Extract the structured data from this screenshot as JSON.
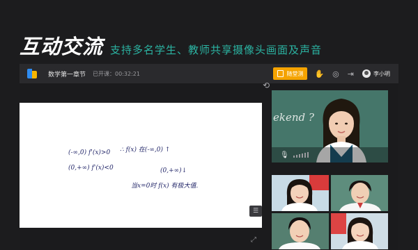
{
  "hero": {
    "title": "互动交流",
    "subtitle": "支持多名学生、教师共享摄像头画面及声音"
  },
  "topbar": {
    "course_title": "数学第一章节",
    "timer_label": "已开课：",
    "timer_value": "00:32:21",
    "quiz_button": "随堂测",
    "user_name": "李小明"
  },
  "board": {
    "lines": [
      "(-∞,0) f'(x)>0",
      "∴ f(x) 在(-∞,0) ↑",
      "(0,+∞) f'(x)<0",
      "(0,+∞)↓",
      "当x=0时 f(x) 有极大值."
    ]
  },
  "teacher_cam": {
    "chalk_text": "ekend ?"
  },
  "colors": {
    "accent": "#2bb3a2",
    "quiz_button": "#f5a300",
    "topbar": "#2a2a2d",
    "background": "#1c1c1e"
  }
}
